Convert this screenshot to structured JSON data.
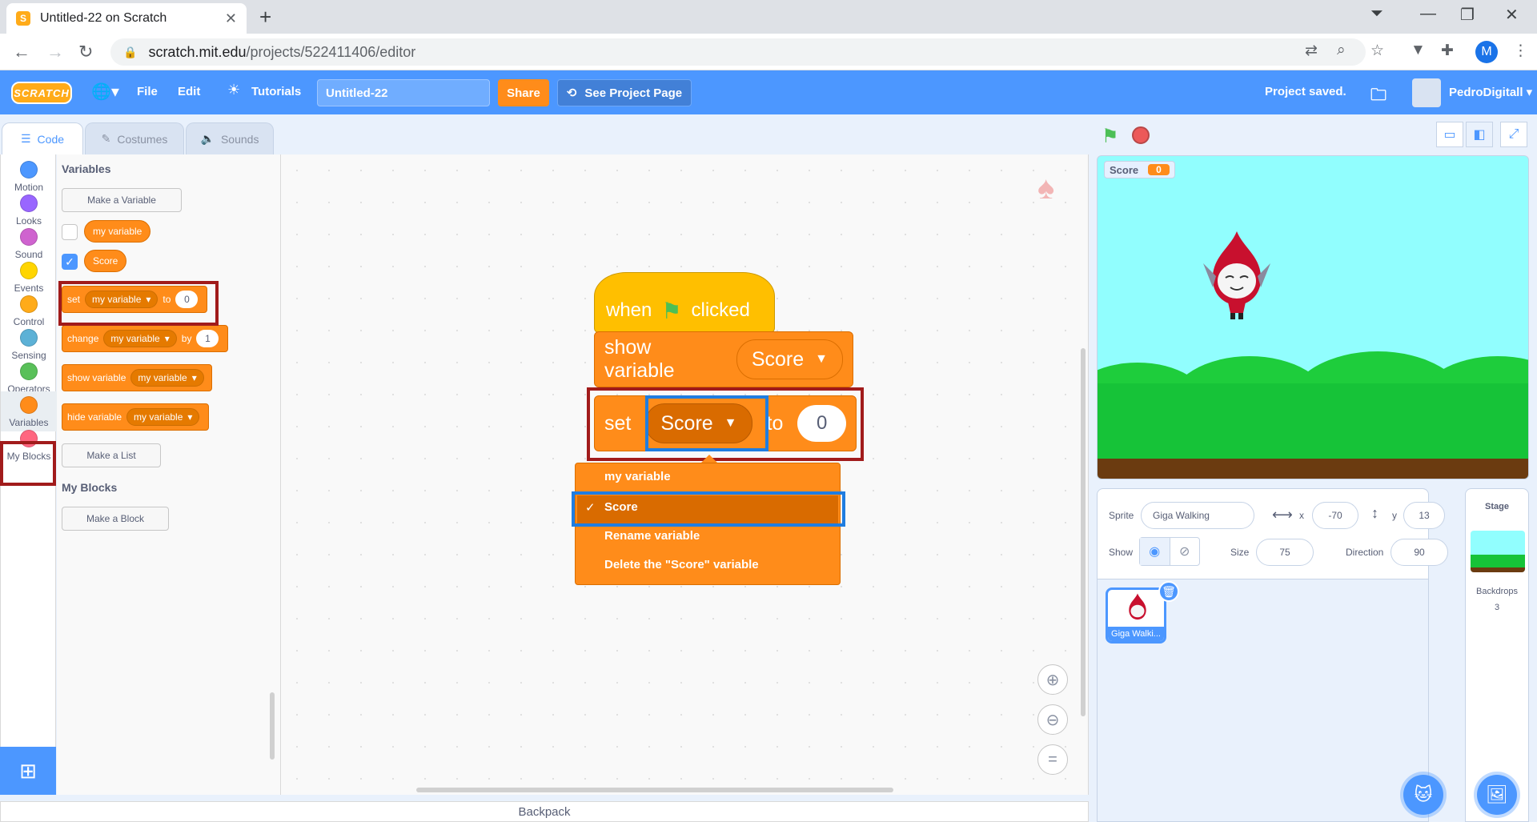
{
  "browser": {
    "tab_title": "Untitled-22 on Scratch",
    "url_host": "scratch.mit.edu",
    "url_path": "/projects/522411406/editor",
    "profile_initial": "M"
  },
  "menubar": {
    "logo": "SCRATCH",
    "file": "File",
    "edit": "Edit",
    "tutorials": "Tutorials",
    "project_title": "Untitled-22",
    "share": "Share",
    "see_project_page": "See Project Page",
    "status": "Project saved.",
    "username": "PedroDigitall"
  },
  "editor_tabs": [
    {
      "label": "Code",
      "active": true
    },
    {
      "label": "Costumes",
      "active": false
    },
    {
      "label": "Sounds",
      "active": false
    }
  ],
  "categories": [
    {
      "label": "Motion",
      "color": "#4c97ff"
    },
    {
      "label": "Looks",
      "color": "#9966ff"
    },
    {
      "label": "Sound",
      "color": "#cf63cf"
    },
    {
      "label": "Events",
      "color": "#ffd500"
    },
    {
      "label": "Control",
      "color": "#ffab19"
    },
    {
      "label": "Sensing",
      "color": "#5cb1d6"
    },
    {
      "label": "Operators",
      "color": "#59c059"
    },
    {
      "label": "Variables",
      "color": "#ff8c1a",
      "selected": true
    },
    {
      "label": "My Blocks",
      "color": "#ff6680"
    }
  ],
  "palette": {
    "heading_variables": "Variables",
    "make_variable": "Make a Variable",
    "variables": [
      {
        "name": "my variable",
        "checked": false
      },
      {
        "name": "Score",
        "checked": true
      }
    ],
    "set_block": {
      "verb": "set",
      "var": "my variable",
      "to": "to",
      "value": "0"
    },
    "change_block": {
      "verb": "change",
      "var": "my variable",
      "by": "by",
      "value": "1"
    },
    "show_block": {
      "verb": "show variable",
      "var": "my variable"
    },
    "hide_block": {
      "verb": "hide variable",
      "var": "my variable"
    },
    "make_list": "Make a List",
    "heading_myblocks": "My Blocks",
    "make_block": "Make a Block"
  },
  "script": {
    "hat_when": "when",
    "hat_clicked": "clicked",
    "show_verb": "show variable",
    "show_var": "Score",
    "set_verb": "set",
    "set_var": "Score",
    "set_to": "to",
    "set_value": "0"
  },
  "dropdown": {
    "items": [
      "my variable",
      "Score",
      "Rename variable",
      "Delete the \"Score\" variable"
    ],
    "selected_index": 1,
    "check": "✓"
  },
  "backpack": "Backpack",
  "stage": {
    "monitor_label": "Score",
    "monitor_value": "0"
  },
  "sprite_info": {
    "sprite_label": "Sprite",
    "sprite_name": "Giga Walking",
    "x_label": "x",
    "x_value": "-70",
    "y_label": "y",
    "y_value": "13",
    "show_label": "Show",
    "size_label": "Size",
    "size_value": "75",
    "direction_label": "Direction",
    "direction_value": "90"
  },
  "sprites": [
    {
      "name": "Giga Walki..."
    }
  ],
  "stage_panel": {
    "title": "Stage",
    "backdrops_label": "Backdrops",
    "backdrops_count": "3"
  }
}
